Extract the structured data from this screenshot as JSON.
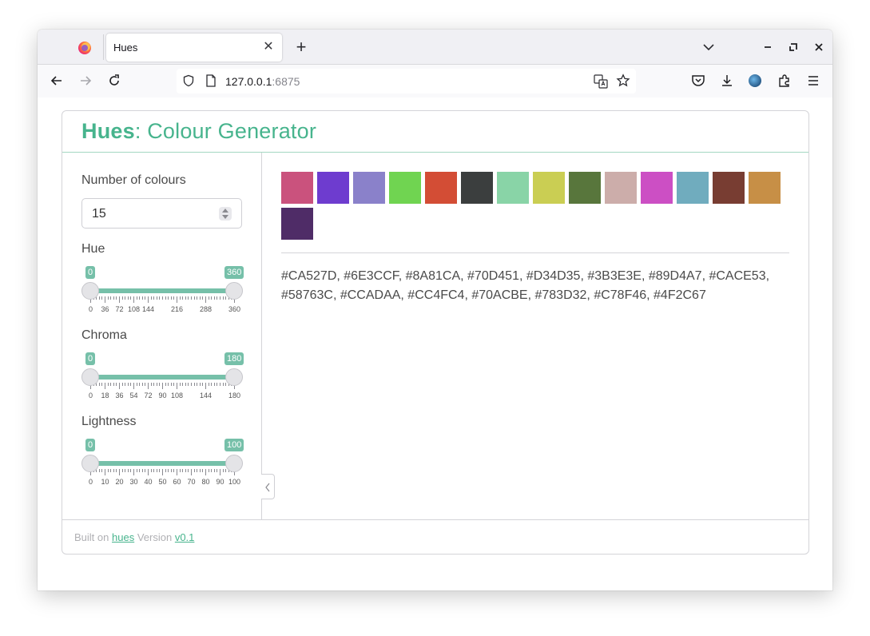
{
  "browser": {
    "tab_title": "Hues",
    "url_host": "127.0.0.1",
    "url_port": ":6875"
  },
  "app": {
    "title_bold": "Hues",
    "title_rest": ": Colour Generator"
  },
  "controls": {
    "num_colours_label": "Number of colours",
    "num_colours_value": "15",
    "hue": {
      "label": "Hue",
      "min_bubble": "0",
      "max_bubble": "360",
      "ticks": [
        "0",
        "36",
        "72",
        "108",
        "144",
        "216",
        "288",
        "360"
      ]
    },
    "chroma": {
      "label": "Chroma",
      "min_bubble": "0",
      "max_bubble": "180",
      "ticks": [
        "0",
        "18",
        "36",
        "54",
        "72",
        "90",
        "108",
        "144",
        "180"
      ]
    },
    "lightness": {
      "label": "Lightness",
      "min_bubble": "0",
      "max_bubble": "100",
      "ticks": [
        "0",
        "10",
        "20",
        "30",
        "40",
        "50",
        "60",
        "70",
        "80",
        "90",
        "100"
      ]
    }
  },
  "palette": {
    "colors": [
      "#CA527D",
      "#6E3CCF",
      "#8A81CA",
      "#70D451",
      "#D34D35",
      "#3B3E3E",
      "#89D4A7",
      "#CACE53",
      "#58763C",
      "#CCADAA",
      "#CC4FC4",
      "#70ACBE",
      "#783D32",
      "#C78F46",
      "#4F2C67"
    ],
    "hex_text": "#CA527D, #6E3CCF, #8A81CA, #70D451, #D34D35, #3B3E3E, #89D4A7, #CACE53, #58763C, #CCADAA, #CC4FC4, #70ACBE, #783D32, #C78F46, #4F2C67"
  },
  "footer": {
    "built_on": "Built on",
    "hues_link": "hues",
    "version_text": "Version",
    "version_link": "v0.1"
  },
  "accent_color": "#47b48d"
}
